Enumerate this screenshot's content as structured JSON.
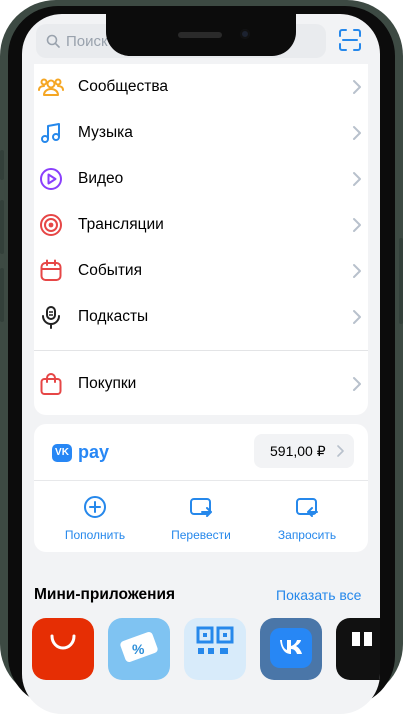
{
  "search": {
    "placeholder": "Поиск"
  },
  "menu": [
    {
      "label": "Сообщества",
      "icon": "communities-icon"
    },
    {
      "label": "Музыка",
      "icon": "music-note-icon"
    },
    {
      "label": "Видео",
      "icon": "video-play-icon"
    },
    {
      "label": "Трансляции",
      "icon": "broadcast-icon"
    },
    {
      "label": "События",
      "icon": "calendar-icon"
    },
    {
      "label": "Подкасты",
      "icon": "podcast-mic-icon"
    },
    {
      "label": "Покупки",
      "icon": "shopping-bag-icon"
    }
  ],
  "pay": {
    "brand": "pay",
    "vk": "VK",
    "balance": "591,00 ₽",
    "actions": [
      {
        "label": "Пополнить",
        "icon": "plus-circle-icon"
      },
      {
        "label": "Перевести",
        "icon": "wallet-send-icon"
      },
      {
        "label": "Запросить",
        "icon": "wallet-request-icon"
      }
    ]
  },
  "mini_apps": {
    "title": "Мини-приложения",
    "show_all": "Показать все",
    "apps": [
      "aliexpress-app-icon",
      "discount-ticket-app-icon",
      "qr-code-app-icon",
      "vk-app-icon",
      "black-app-icon"
    ]
  },
  "colors": {
    "accent": "#2688eb",
    "background": "#f2f3f5"
  }
}
